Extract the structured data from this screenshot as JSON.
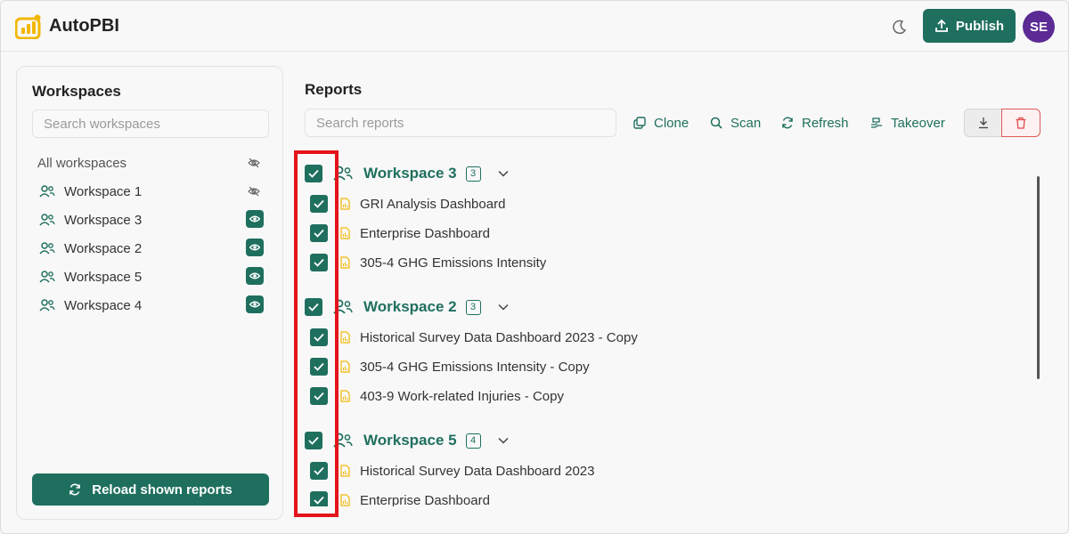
{
  "app": {
    "title": "AutoPBI",
    "publish_label": "Publish",
    "avatar_initials": "SE",
    "brand_color": "#1f6f5f",
    "avatar_color": "#5b2a94"
  },
  "sidebar": {
    "title": "Workspaces",
    "search_placeholder": "Search workspaces",
    "all_label": "All workspaces",
    "items": [
      {
        "label": "Workspace 1",
        "visible": false
      },
      {
        "label": "Workspace 3",
        "visible": true
      },
      {
        "label": "Workspace 2",
        "visible": true
      },
      {
        "label": "Workspace 5",
        "visible": true
      },
      {
        "label": "Workspace 4",
        "visible": true
      }
    ],
    "reload_label": "Reload shown reports"
  },
  "main": {
    "title": "Reports",
    "search_placeholder": "Search reports",
    "actions": {
      "clone": "Clone",
      "scan": "Scan",
      "refresh": "Refresh",
      "takeover": "Takeover"
    },
    "groups": [
      {
        "name": "Workspace 3",
        "count": "3",
        "checked": true,
        "reports": [
          "GRI Analysis Dashboard",
          "Enterprise Dashboard",
          "305-4 GHG Emissions Intensity"
        ]
      },
      {
        "name": "Workspace 2",
        "count": "3",
        "checked": true,
        "reports": [
          "Historical Survey Data Dashboard 2023 - Copy",
          "305-4 GHG Emissions Intensity - Copy",
          "403-9 Work-related Injuries - Copy"
        ]
      },
      {
        "name": "Workspace 5",
        "count": "4",
        "checked": true,
        "reports": [
          "Historical Survey Data Dashboard 2023",
          "Enterprise Dashboard"
        ]
      }
    ]
  }
}
